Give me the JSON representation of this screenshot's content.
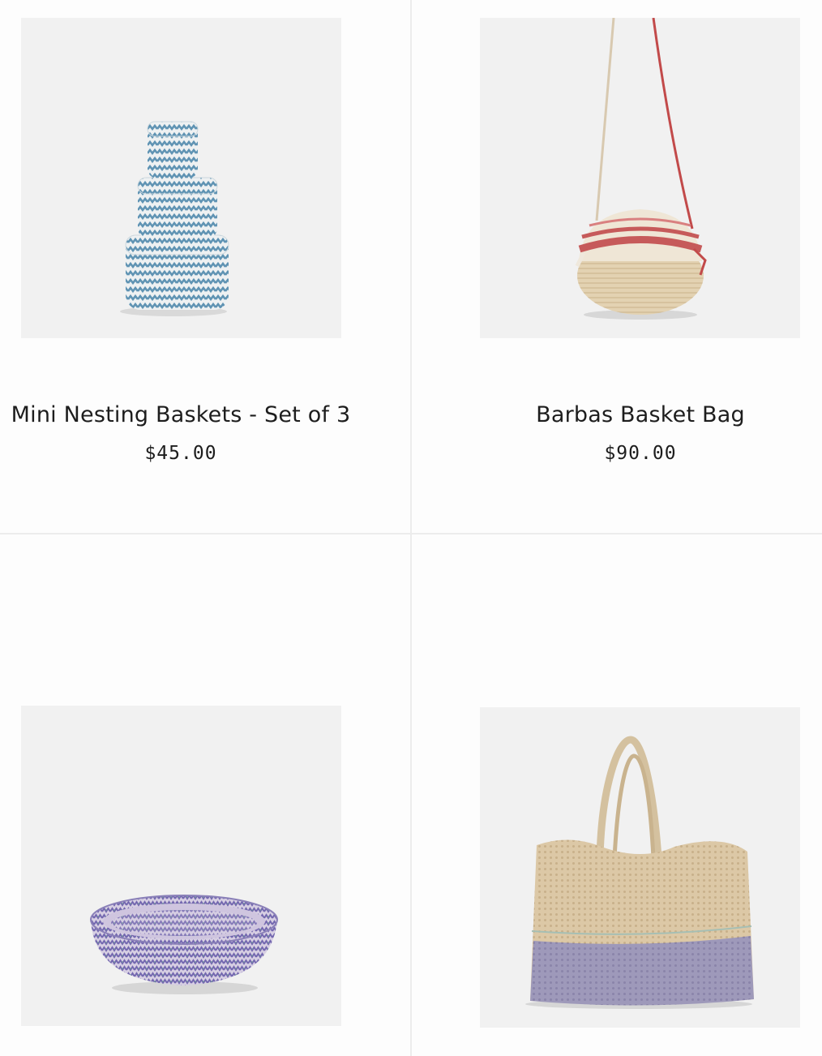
{
  "products": [
    {
      "title": "Mini Nesting Baskets - Set of 3",
      "price": "$45.00",
      "image": "blue-chevron-nesting-baskets"
    },
    {
      "title": "Barbas Basket Bag",
      "price": "$90.00",
      "image": "round-raffia-basket-bag-with-red-strap"
    },
    {
      "title": "",
      "price": "",
      "image": "purple-woven-bowl"
    },
    {
      "title": "",
      "price": "",
      "image": "raffia-tote-purple-bottom"
    }
  ],
  "colors": {
    "background": "#fdfdfd",
    "image_background": "#f1f1f1",
    "divider": "#ececec",
    "text": "#1d1d1d"
  }
}
